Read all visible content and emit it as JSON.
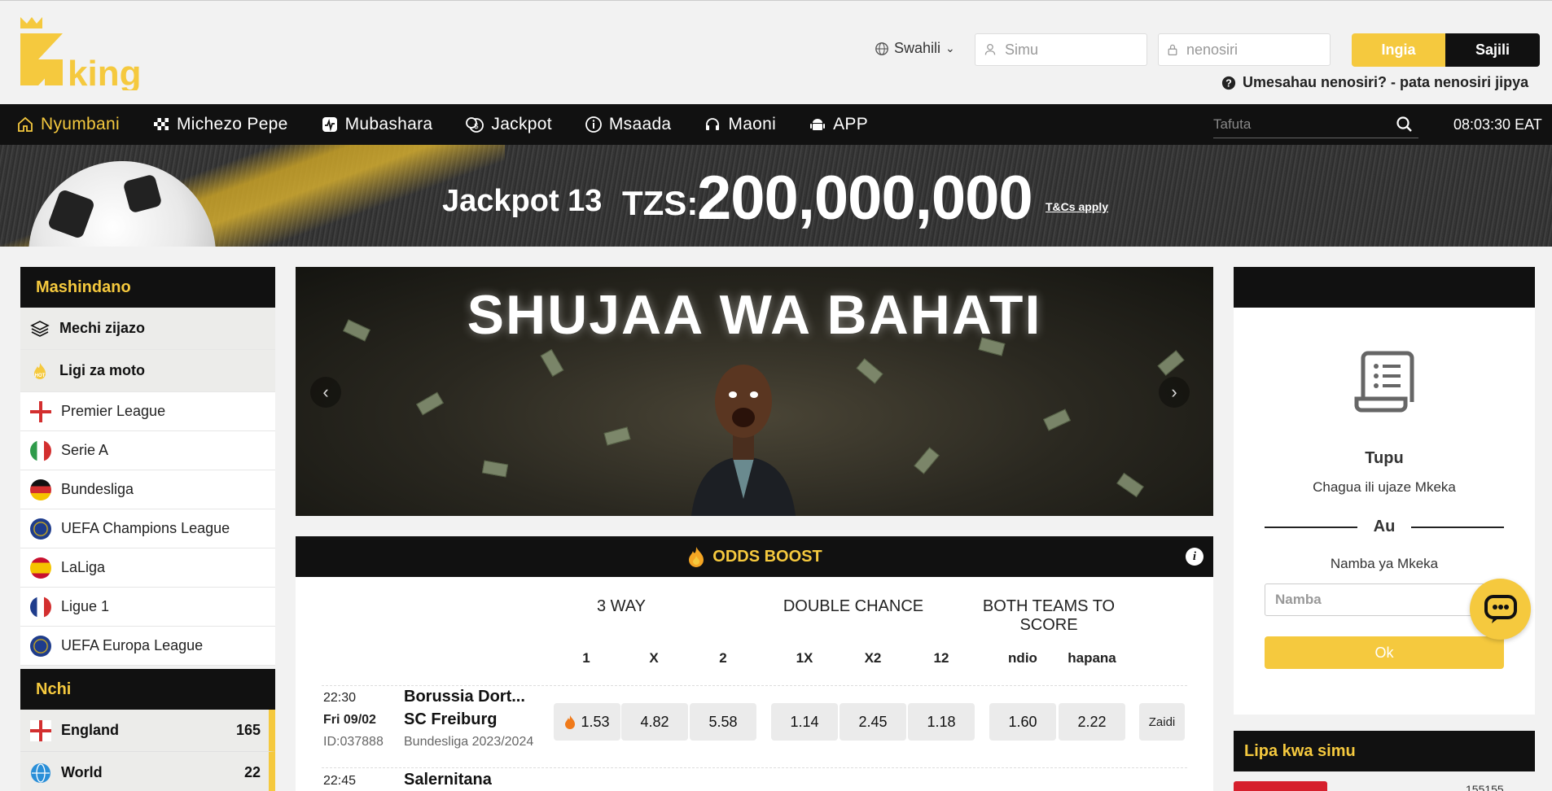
{
  "header": {
    "brand": "king",
    "language": "Swahili",
    "phone_placeholder": "Simu",
    "password_placeholder": "nenosiri",
    "login_label": "Ingia",
    "register_label": "Sajili",
    "forgot_text": "Umesahau nenosiri? - pata nenosiri jipya"
  },
  "nav": {
    "items": [
      {
        "label": "Nyumbani",
        "icon": "home-icon"
      },
      {
        "label": "Michezo Pepe",
        "icon": "checkered-flag-icon"
      },
      {
        "label": "Mubashara",
        "icon": "live-icon"
      },
      {
        "label": "Jackpot",
        "icon": "coins-icon"
      },
      {
        "label": "Msaada",
        "icon": "info-icon"
      },
      {
        "label": "Maoni",
        "icon": "headset-icon"
      },
      {
        "label": "APP",
        "icon": "android-icon"
      }
    ],
    "search_placeholder": "Tafuta",
    "time": "08:03:30 EAT"
  },
  "jackpot": {
    "label": "Jackpot 13",
    "currency": "TZS:",
    "amount": "200,000,000",
    "terms": "T&Cs apply"
  },
  "sidebar": {
    "competitions_title": "Mashindano",
    "upcoming": "Mechi zijazo",
    "hot_leagues": "Ligi za moto",
    "leagues": [
      "Premier League",
      "Serie A",
      "Bundesliga",
      "UEFA Champions League",
      "LaLiga",
      "Ligue 1",
      "UEFA Europa League"
    ],
    "countries_title": "Nchi",
    "countries": [
      {
        "name": "England",
        "count": "165"
      },
      {
        "name": "World",
        "count": "22"
      }
    ]
  },
  "carousel": {
    "title": "SHUJAA WA BAHATI"
  },
  "odds_boost": {
    "title": "ODDS BOOST",
    "groups": [
      "3 WAY",
      "DOUBLE CHANCE",
      "BOTH TEAMS TO SCORE"
    ],
    "columns": [
      "1",
      "X",
      "2",
      "1X",
      "X2",
      "12",
      "ndio",
      "hapana"
    ],
    "matches": [
      {
        "time": "22:30",
        "date": "Fri 09/02",
        "id": "ID:037888",
        "home": "Borussia Dort...",
        "away": "SC Freiburg",
        "league": "Bundesliga 2023/2024",
        "odds": [
          "1.53",
          "4.82",
          "5.58",
          "1.14",
          "2.45",
          "1.18",
          "1.60",
          "2.22"
        ],
        "more": "Zaidi"
      },
      {
        "time": "22:45",
        "home": "Salernitana"
      }
    ]
  },
  "betslip": {
    "empty_title": "Tupu",
    "empty_sub": "Chagua ili ujaze Mkeka",
    "or": "Au",
    "code_label": "Namba ya Mkeka",
    "code_placeholder": "Namba",
    "ok_label": "Ok"
  },
  "mobile_pay": {
    "title": "Lipa kwa simu",
    "number_partial": "155155"
  },
  "colors": {
    "accent": "#f5c93e",
    "dark": "#111111"
  }
}
